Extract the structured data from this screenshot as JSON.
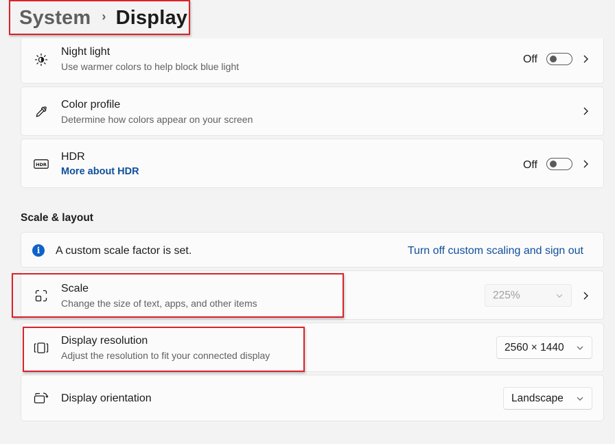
{
  "breadcrumb": {
    "parent": "System",
    "separator": "›",
    "current": "Display"
  },
  "night_light": {
    "title": "Night light",
    "subtitle": "Use warmer colors to help block blue light",
    "state": "Off",
    "icon": "brightness-icon"
  },
  "color_profile": {
    "title": "Color profile",
    "subtitle": "Determine how colors appear on your screen",
    "icon": "eyedropper-icon"
  },
  "hdr": {
    "title": "HDR",
    "link": "More about HDR",
    "state": "Off",
    "icon": "hdr-icon"
  },
  "scale_layout": {
    "heading": "Scale & layout",
    "info": {
      "text": "A custom scale factor is set.",
      "link": "Turn off custom scaling and sign out",
      "icon_glyph": "i"
    },
    "scale": {
      "title": "Scale",
      "subtitle": "Change the size of text, apps, and other items",
      "value": "225%",
      "disabled": true,
      "icon": "scale-icon"
    },
    "resolution": {
      "title": "Display resolution",
      "subtitle": "Adjust the resolution to fit your connected display",
      "value": "2560 × 1440",
      "icon": "resolution-icon"
    },
    "orientation": {
      "title": "Display orientation",
      "value": "Landscape",
      "icon": "orientation-icon"
    }
  },
  "colors": {
    "accent": "#0f4f9c",
    "highlight": "#d9222a",
    "info": "#0f62c7"
  }
}
